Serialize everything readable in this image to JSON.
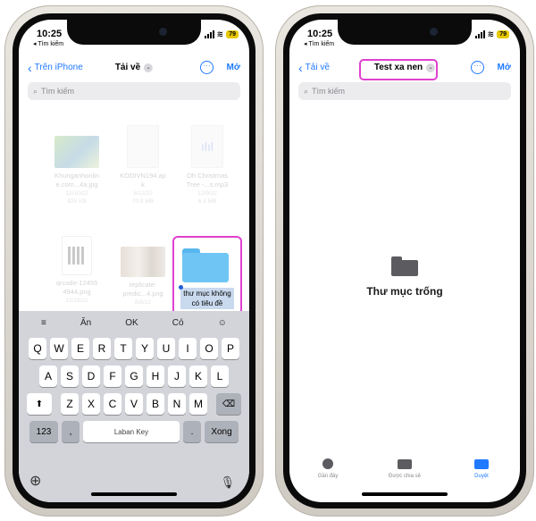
{
  "left": {
    "status": {
      "time": "10:25",
      "back_app": "◂ Tìm kiếm",
      "battery": "79"
    },
    "nav": {
      "back_label": "Trên iPhone",
      "title": "Tải về",
      "open_label": "Mở"
    },
    "search": {
      "placeholder": "Tìm kiếm"
    },
    "files": [
      {
        "name_line1": "Khunganhonlin",
        "name_line2": "e.com...4a.jpg",
        "date": "12/10/22",
        "size": "825 KB"
      },
      {
        "name_line1": "KODIVN194.ap",
        "name_line2": "k",
        "date": "5/12/22",
        "size": "70.8 MB"
      },
      {
        "name_line1": "Oh Christmas",
        "name_line2": "Tree -...s.mp3",
        "date": "12/9/22",
        "size": "6.3 MB"
      },
      {
        "name_line1": "qrcode-12455",
        "name_line2": "4944.png",
        "date": "12/19/22",
        "size": ""
      },
      {
        "name_line1": "replicate-",
        "name_line2": "predic...4.png",
        "date": "8/8/22",
        "size": ""
      }
    ],
    "new_folder": {
      "name_line1": "thư mục không",
      "name_line2": "có tiêu đề"
    },
    "keyboard": {
      "suggestions": [
        "Ăn",
        "OK",
        "Có"
      ],
      "row1": [
        "Q",
        "W",
        "E",
        "R",
        "T",
        "Y",
        "U",
        "I",
        "O",
        "P"
      ],
      "row2": [
        "A",
        "S",
        "D",
        "F",
        "G",
        "H",
        "J",
        "K",
        "L"
      ],
      "row3": [
        "Z",
        "X",
        "C",
        "V",
        "B",
        "N",
        "M"
      ],
      "num_label": "123",
      "comma_label": ",",
      "space_label": "Laban Key",
      "period_label": ".",
      "return_label": "Xong"
    }
  },
  "right": {
    "status": {
      "time": "10:25",
      "back_app": "◂ Tìm kiếm",
      "battery": "79"
    },
    "nav": {
      "back_label": "Tải về",
      "title": "Test xa nen",
      "open_label": "Mở"
    },
    "search": {
      "placeholder": "Tìm kiếm"
    },
    "empty_message": "Thư mục trống",
    "tabs": [
      {
        "label": "Gần đây",
        "icon": "clock-icon"
      },
      {
        "label": "Được chia sẻ",
        "icon": "shared-folder-icon"
      },
      {
        "label": "Duyệt",
        "icon": "folder-icon"
      }
    ]
  },
  "colors": {
    "accent": "#1f7aff",
    "highlight": "#e040d0",
    "folder": "#6fc6f4"
  }
}
